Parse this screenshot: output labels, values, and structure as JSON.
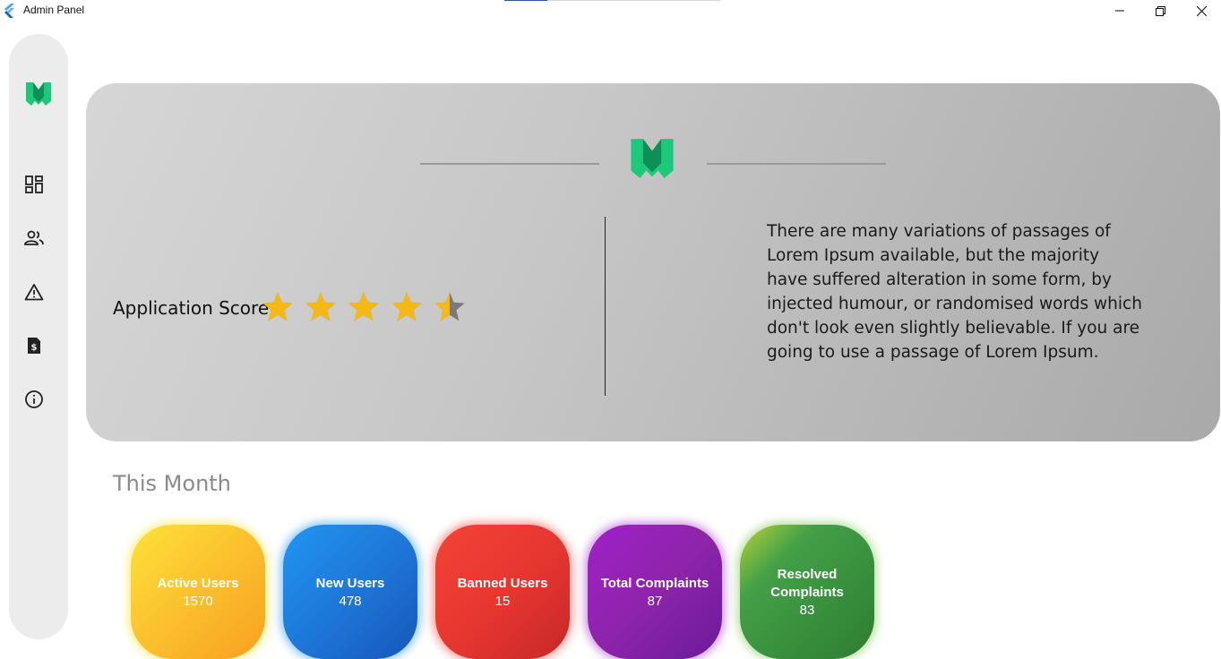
{
  "window": {
    "title": "Admin Panel",
    "progress": 0.2
  },
  "sidebar": {
    "logo": "mosque-m-logo",
    "items": [
      {
        "icon": "dashboard-icon"
      },
      {
        "icon": "users-icon"
      },
      {
        "icon": "warning-icon"
      },
      {
        "icon": "receipt-icon"
      },
      {
        "icon": "info-icon"
      }
    ]
  },
  "hero": {
    "score_label": "Application Score:",
    "rating": 4.5,
    "rating_max": 5,
    "description": "There are many variations of passages of Lorem Ipsum available, but the majority have suffered alteration in some form, by injected humour, or randomised words which don't look even slightly believable. If you are going to use a passage of Lorem Ipsum."
  },
  "section": {
    "title": "This Month"
  },
  "stats": [
    {
      "label": "Active Users",
      "value": "1570",
      "color": "#fbc02d"
    },
    {
      "label": "New Users",
      "value": "478",
      "color": "#1e74d6"
    },
    {
      "label": "Banned Users",
      "value": "15",
      "color": "#e53530"
    },
    {
      "label": "Total Complaints",
      "value": "87",
      "color": "#8e24aa"
    },
    {
      "label": "Resolved Complaints",
      "value": "83",
      "color": "#388e3c"
    }
  ],
  "colors": {
    "brand_green": "#1ec87a",
    "brand_green_dark": "#0f8f58",
    "star_gold": "#f6b814",
    "star_empty": "#7a7a7a"
  }
}
